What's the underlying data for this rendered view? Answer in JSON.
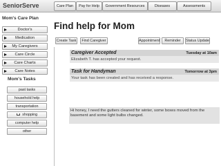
{
  "header": {
    "brand": "SeniorServe",
    "tabs": [
      "Care Plan",
      "Pay for Help",
      "Government Resources",
      "Diseases",
      "Assessments"
    ]
  },
  "sidebar": {
    "care_plan_heading": "Mom's Care Plan",
    "items": [
      "Doctor's",
      "Medication",
      "My Caregivers",
      "Care Circle",
      "Care Charts",
      "Care Notes"
    ],
    "tasks_heading": "Mom's Tasks",
    "tasks": [
      "past tasks",
      "household help",
      "transportation",
      "shopping",
      "computer help",
      "other"
    ]
  },
  "main": {
    "title": "Find help for Mom",
    "actions_left": [
      "Create Task",
      "Find Caregiver"
    ],
    "actions_right": [
      "Appointment",
      "Reminder",
      "Status Update"
    ]
  },
  "feed": [
    {
      "title": "Caregiver Accepted",
      "time": "Tuesday at 10am",
      "body": "Elizabeth T. has accepted your request."
    },
    {
      "title": "Task for Handyman",
      "time": "Tomorrow at 3pm",
      "body": "Your task has been created and has received a response."
    }
  ],
  "message": "Hi honey, I need the gutters cleaned for winter, some boxes moved from the basement and some light bulbs changed."
}
